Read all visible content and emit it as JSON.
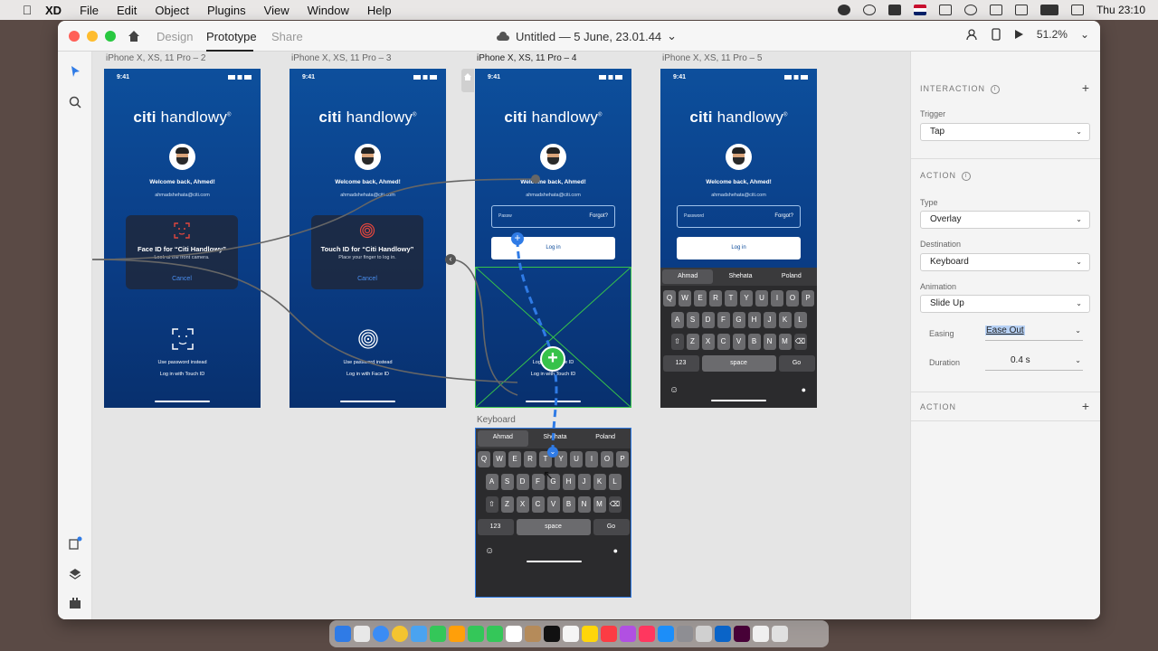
{
  "menubar": {
    "app_name": "XD",
    "items": [
      "File",
      "Edit",
      "Object",
      "Plugins",
      "View",
      "Window",
      "Help"
    ],
    "clock": "Thu 23:10"
  },
  "titlebar": {
    "tabs": [
      "Design",
      "Prototype",
      "Share"
    ],
    "active_tab": "Prototype",
    "doc_title": "Untitled — 5 June, 23.01.44",
    "zoom": "51.2%"
  },
  "artboards": [
    {
      "label": "iPhone X, XS, 11 Pro – 2",
      "time": "9:41",
      "logo_a": "citi",
      "logo_b": " handlowy",
      "logo_mark": "®",
      "welcome": "Welcome back, Ahmed!",
      "email": "ahmadshehata@citi.com",
      "dialog_title": "Face ID for “Citi Handlowy”",
      "dialog_sub": "Look at the front camera.",
      "dialog_cancel": "Cancel",
      "alt1": "Use password instead",
      "alt2": "Log in with Touch ID"
    },
    {
      "label": "iPhone X, XS, 11 Pro – 3",
      "time": "9:41",
      "logo_a": "citi",
      "logo_b": " handlowy",
      "logo_mark": "®",
      "welcome": "Welcome back, Ahmed!",
      "email": "ahmadshehata@citi.com",
      "dialog_title": "Touch ID for “Citi Handlowy”",
      "dialog_sub": "Place your finger to log in.",
      "dialog_cancel": "Cancel",
      "alt1": "Use password instead",
      "alt2": "Log in with Face ID"
    },
    {
      "label": "iPhone X, XS, 11 Pro – 4",
      "time": "9:41",
      "logo_a": "citi",
      "logo_b": " handlowy",
      "logo_mark": "®",
      "welcome": "Welcome back, Ahmed!",
      "email": "ahmadshehata@citi.com",
      "password_placeholder": "Passw",
      "forgot": "Forgot?",
      "login": "Log in",
      "alt1": "Login with Face ID",
      "alt2": "Log in with Touch ID"
    },
    {
      "label": "iPhone X, XS, 11 Pro – 5",
      "time": "9:41",
      "logo_a": "citi",
      "logo_b": " handlowy",
      "logo_mark": "®",
      "welcome": "Welcome back, Ahmed!",
      "email": "ahmadshehata@citi.com",
      "password_placeholder": "Password",
      "forgot": "Forgot?",
      "login": "Log in"
    }
  ],
  "keyboard": {
    "label": "Keyboard",
    "suggestions": [
      "Ahmad",
      "Shehata",
      "Poland"
    ],
    "row1": [
      "Q",
      "W",
      "E",
      "R",
      "T",
      "Y",
      "U",
      "I",
      "O",
      "P"
    ],
    "row2": [
      "A",
      "S",
      "D",
      "F",
      "G",
      "H",
      "J",
      "K",
      "L"
    ],
    "row3": [
      "Z",
      "X",
      "C",
      "V",
      "B",
      "N",
      "M"
    ],
    "numbers_key": "123",
    "space_key": "space",
    "go_key": "Go"
  },
  "panel": {
    "interaction_heading": "INTERACTION",
    "trigger_label": "Trigger",
    "trigger_value": "Tap",
    "action_heading": "ACTION",
    "type_label": "Type",
    "type_value": "Overlay",
    "destination_label": "Destination",
    "destination_value": "Keyboard",
    "animation_label": "Animation",
    "animation_value": "Slide Up",
    "easing_label": "Easing",
    "easing_value": "Ease Out",
    "duration_label": "Duration",
    "duration_value": "0.4 s",
    "action2_heading": "ACTION"
  },
  "colors": {
    "artboard_blue": "#0d4f9c",
    "link_blue": "#2f7be6",
    "selection_green": "#37c24a"
  }
}
